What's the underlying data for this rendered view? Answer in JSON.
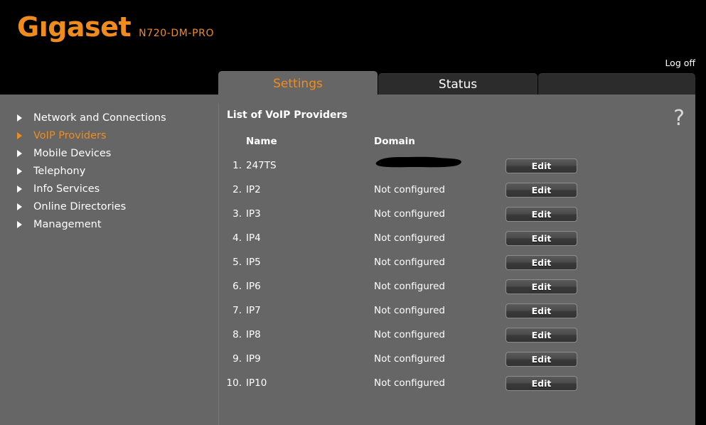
{
  "brand": {
    "logo_text": "Gıgaset",
    "model": "N720-DM-PRO"
  },
  "header": {
    "logoff_label": "Log off"
  },
  "tabs": [
    {
      "label": "Settings",
      "active": true
    },
    {
      "label": "Status",
      "active": false
    },
    {
      "label": "",
      "active": false
    }
  ],
  "sidebar": {
    "items": [
      {
        "label": "Network and Connections",
        "active": false,
        "icon": "triangle-right-icon"
      },
      {
        "label": "VoIP Providers",
        "active": true,
        "icon": "triangle-right-icon"
      },
      {
        "label": "Mobile Devices",
        "active": false,
        "icon": "triangle-right-icon"
      },
      {
        "label": "Telephony",
        "active": false,
        "icon": "triangle-right-icon"
      },
      {
        "label": "Info Services",
        "active": false,
        "icon": "triangle-right-icon"
      },
      {
        "label": "Online Directories",
        "active": false,
        "icon": "triangle-right-icon"
      },
      {
        "label": "Management",
        "active": false,
        "icon": "triangle-right-icon"
      }
    ]
  },
  "content": {
    "title": "List of VoIP Providers",
    "help_icon": "?",
    "columns": [
      "",
      "Name",
      "Domain",
      ""
    ],
    "column_headers": {
      "name": "Name",
      "domain": "Domain"
    },
    "edit_label": "Edit",
    "not_configured_label": "Not configured",
    "rows": [
      {
        "num": "1.",
        "name": "247TS",
        "domain": "",
        "domain_redacted": true,
        "action": "Edit"
      },
      {
        "num": "2.",
        "name": "IP2",
        "domain": "Not configured",
        "domain_redacted": false,
        "action": "Edit"
      },
      {
        "num": "3.",
        "name": "IP3",
        "domain": "Not configured",
        "domain_redacted": false,
        "action": "Edit"
      },
      {
        "num": "4.",
        "name": "IP4",
        "domain": "Not configured",
        "domain_redacted": false,
        "action": "Edit"
      },
      {
        "num": "5.",
        "name": "IP5",
        "domain": "Not configured",
        "domain_redacted": false,
        "action": "Edit"
      },
      {
        "num": "6.",
        "name": "IP6",
        "domain": "Not configured",
        "domain_redacted": false,
        "action": "Edit"
      },
      {
        "num": "7.",
        "name": "IP7",
        "domain": "Not configured",
        "domain_redacted": false,
        "action": "Edit"
      },
      {
        "num": "8.",
        "name": "IP8",
        "domain": "Not configured",
        "domain_redacted": false,
        "action": "Edit"
      },
      {
        "num": "9.",
        "name": "IP9",
        "domain": "Not configured",
        "domain_redacted": false,
        "action": "Edit"
      },
      {
        "num": "10.",
        "name": "IP10",
        "domain": "Not configured",
        "domain_redacted": false,
        "action": "Edit"
      }
    ]
  },
  "colors": {
    "brand_orange": "#f08c1e",
    "panel_gray": "#666666",
    "tab_inactive": "#2c2c2c",
    "page_black": "#000000",
    "text_white": "#ffffff",
    "redaction_black": "#000000"
  }
}
